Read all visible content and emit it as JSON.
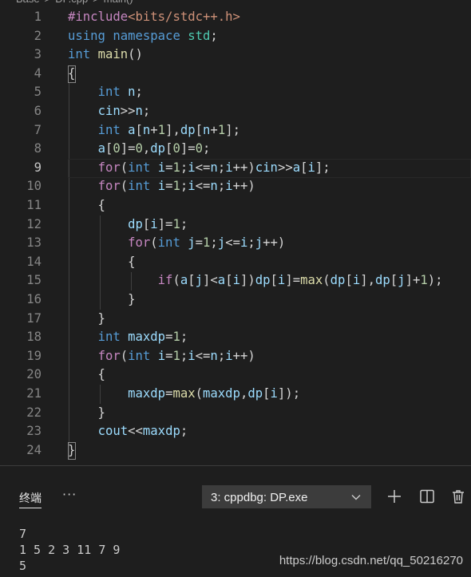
{
  "breadcrumb": {
    "items": [
      "Base",
      ">",
      "DP.cpp",
      ">",
      "main()"
    ]
  },
  "editor": {
    "lines": [
      {
        "num": "1",
        "tokens": [
          [
            "c",
            "#include"
          ],
          [
            "s",
            "<bits/stdc++.h>"
          ]
        ]
      },
      {
        "num": "2",
        "tokens": [
          [
            "k",
            "using "
          ],
          [
            "k",
            "namespace "
          ],
          [
            "t",
            "std"
          ],
          [
            "d",
            ";"
          ]
        ]
      },
      {
        "num": "3",
        "tokens": [
          [
            "k",
            "int "
          ],
          [
            "f",
            "main"
          ],
          [
            "d",
            "()"
          ]
        ]
      },
      {
        "num": "4",
        "tokens": [
          [
            "d",
            "{"
          ]
        ]
      },
      {
        "num": "5",
        "tokens": [
          [
            "d",
            "    "
          ],
          [
            "k",
            "int "
          ],
          [
            "v",
            "n"
          ],
          [
            "d",
            ";"
          ]
        ]
      },
      {
        "num": "6",
        "tokens": [
          [
            "d",
            "    "
          ],
          [
            "v",
            "cin"
          ],
          [
            "d",
            ">>"
          ],
          [
            "v",
            "n"
          ],
          [
            "d",
            ";"
          ]
        ]
      },
      {
        "num": "7",
        "tokens": [
          [
            "d",
            "    "
          ],
          [
            "k",
            "int "
          ],
          [
            "v",
            "a"
          ],
          [
            "d",
            "["
          ],
          [
            "v",
            "n"
          ],
          [
            "d",
            "+"
          ],
          [
            "n",
            "1"
          ],
          [
            "d",
            "],"
          ],
          [
            "v",
            "dp"
          ],
          [
            "d",
            "["
          ],
          [
            "v",
            "n"
          ],
          [
            "d",
            "+"
          ],
          [
            "n",
            "1"
          ],
          [
            "d",
            "];"
          ]
        ]
      },
      {
        "num": "8",
        "tokens": [
          [
            "d",
            "    "
          ],
          [
            "v",
            "a"
          ],
          [
            "d",
            "["
          ],
          [
            "n",
            "0"
          ],
          [
            "d",
            "]="
          ],
          [
            "n",
            "0"
          ],
          [
            "d",
            ","
          ],
          [
            "v",
            "dp"
          ],
          [
            "d",
            "["
          ],
          [
            "n",
            "0"
          ],
          [
            "d",
            "]="
          ],
          [
            "n",
            "0"
          ],
          [
            "d",
            ";"
          ]
        ]
      },
      {
        "num": "9",
        "tokens": [
          [
            "d",
            "    "
          ],
          [
            "c",
            "for"
          ],
          [
            "d",
            "("
          ],
          [
            "k",
            "int "
          ],
          [
            "v",
            "i"
          ],
          [
            "d",
            "="
          ],
          [
            "n",
            "1"
          ],
          [
            "d",
            ";"
          ],
          [
            "v",
            "i"
          ],
          [
            "d",
            "<="
          ],
          [
            "v",
            "n"
          ],
          [
            "d",
            ";"
          ],
          [
            "v",
            "i"
          ],
          [
            "d",
            "++)"
          ],
          [
            "v",
            "cin"
          ],
          [
            "d",
            ">>"
          ],
          [
            "v",
            "a"
          ],
          [
            "d",
            "["
          ],
          [
            "v",
            "i"
          ],
          [
            "d",
            "];"
          ]
        ]
      },
      {
        "num": "10",
        "tokens": [
          [
            "d",
            "    "
          ],
          [
            "c",
            "for"
          ],
          [
            "d",
            "("
          ],
          [
            "k",
            "int "
          ],
          [
            "v",
            "i"
          ],
          [
            "d",
            "="
          ],
          [
            "n",
            "1"
          ],
          [
            "d",
            ";"
          ],
          [
            "v",
            "i"
          ],
          [
            "d",
            "<="
          ],
          [
            "v",
            "n"
          ],
          [
            "d",
            ";"
          ],
          [
            "v",
            "i"
          ],
          [
            "d",
            "++)"
          ]
        ]
      },
      {
        "num": "11",
        "tokens": [
          [
            "d",
            "    {"
          ]
        ]
      },
      {
        "num": "12",
        "tokens": [
          [
            "d",
            "        "
          ],
          [
            "v",
            "dp"
          ],
          [
            "d",
            "["
          ],
          [
            "v",
            "i"
          ],
          [
            "d",
            "]="
          ],
          [
            "n",
            "1"
          ],
          [
            "d",
            ";"
          ]
        ]
      },
      {
        "num": "13",
        "tokens": [
          [
            "d",
            "        "
          ],
          [
            "c",
            "for"
          ],
          [
            "d",
            "("
          ],
          [
            "k",
            "int "
          ],
          [
            "v",
            "j"
          ],
          [
            "d",
            "="
          ],
          [
            "n",
            "1"
          ],
          [
            "d",
            ";"
          ],
          [
            "v",
            "j"
          ],
          [
            "d",
            "<="
          ],
          [
            "v",
            "i"
          ],
          [
            "d",
            ";"
          ],
          [
            "v",
            "j"
          ],
          [
            "d",
            "++)"
          ]
        ]
      },
      {
        "num": "14",
        "tokens": [
          [
            "d",
            "        {"
          ]
        ]
      },
      {
        "num": "15",
        "tokens": [
          [
            "d",
            "            "
          ],
          [
            "c",
            "if"
          ],
          [
            "d",
            "("
          ],
          [
            "v",
            "a"
          ],
          [
            "d",
            "["
          ],
          [
            "v",
            "j"
          ],
          [
            "d",
            "]<"
          ],
          [
            "v",
            "a"
          ],
          [
            "d",
            "["
          ],
          [
            "v",
            "i"
          ],
          [
            "d",
            "])"
          ],
          [
            "v",
            "dp"
          ],
          [
            "d",
            "["
          ],
          [
            "v",
            "i"
          ],
          [
            "d",
            "]="
          ],
          [
            "f",
            "max"
          ],
          [
            "d",
            "("
          ],
          [
            "v",
            "dp"
          ],
          [
            "d",
            "["
          ],
          [
            "v",
            "i"
          ],
          [
            "d",
            "],"
          ],
          [
            "v",
            "dp"
          ],
          [
            "d",
            "["
          ],
          [
            "v",
            "j"
          ],
          [
            "d",
            "]+"
          ],
          [
            "n",
            "1"
          ],
          [
            "d",
            ");"
          ]
        ]
      },
      {
        "num": "16",
        "tokens": [
          [
            "d",
            "        }"
          ]
        ]
      },
      {
        "num": "17",
        "tokens": [
          [
            "d",
            "    }"
          ]
        ]
      },
      {
        "num": "18",
        "tokens": [
          [
            "d",
            "    "
          ],
          [
            "k",
            "int "
          ],
          [
            "v",
            "maxdp"
          ],
          [
            "d",
            "="
          ],
          [
            "n",
            "1"
          ],
          [
            "d",
            ";"
          ]
        ]
      },
      {
        "num": "19",
        "tokens": [
          [
            "d",
            "    "
          ],
          [
            "c",
            "for"
          ],
          [
            "d",
            "("
          ],
          [
            "k",
            "int "
          ],
          [
            "v",
            "i"
          ],
          [
            "d",
            "="
          ],
          [
            "n",
            "1"
          ],
          [
            "d",
            ";"
          ],
          [
            "v",
            "i"
          ],
          [
            "d",
            "<="
          ],
          [
            "v",
            "n"
          ],
          [
            "d",
            ";"
          ],
          [
            "v",
            "i"
          ],
          [
            "d",
            "++)"
          ]
        ]
      },
      {
        "num": "20",
        "tokens": [
          [
            "d",
            "    {"
          ]
        ]
      },
      {
        "num": "21",
        "tokens": [
          [
            "d",
            "        "
          ],
          [
            "v",
            "maxdp"
          ],
          [
            "d",
            "="
          ],
          [
            "f",
            "max"
          ],
          [
            "d",
            "("
          ],
          [
            "v",
            "maxdp"
          ],
          [
            "d",
            ","
          ],
          [
            "v",
            "dp"
          ],
          [
            "d",
            "["
          ],
          [
            "v",
            "i"
          ],
          [
            "d",
            "]);"
          ]
        ]
      },
      {
        "num": "22",
        "tokens": [
          [
            "d",
            "    }"
          ]
        ]
      },
      {
        "num": "23",
        "tokens": [
          [
            "d",
            "    "
          ],
          [
            "v",
            "cout"
          ],
          [
            "d",
            "<<"
          ],
          [
            "v",
            "maxdp"
          ],
          [
            "d",
            ";"
          ]
        ]
      },
      {
        "num": "24",
        "tokens": [
          [
            "d",
            "}"
          ]
        ]
      }
    ],
    "active_line": "9"
  },
  "panel": {
    "tab_label": "终端",
    "more": "···",
    "terminal_select": "3: cppdbg: DP.exe",
    "output": [
      "7",
      "1 5 2 3 11 7 9",
      "5"
    ]
  },
  "watermark": "https://blog.csdn.net/qq_50216270",
  "colors": {
    "background": "#1e1e1e",
    "keyword": "#569cd6",
    "control": "#c586c0",
    "function": "#dcdcaa",
    "variable": "#9cdcfe",
    "number": "#b5cea8",
    "type": "#4ec9b0",
    "string": "#ce9178"
  }
}
